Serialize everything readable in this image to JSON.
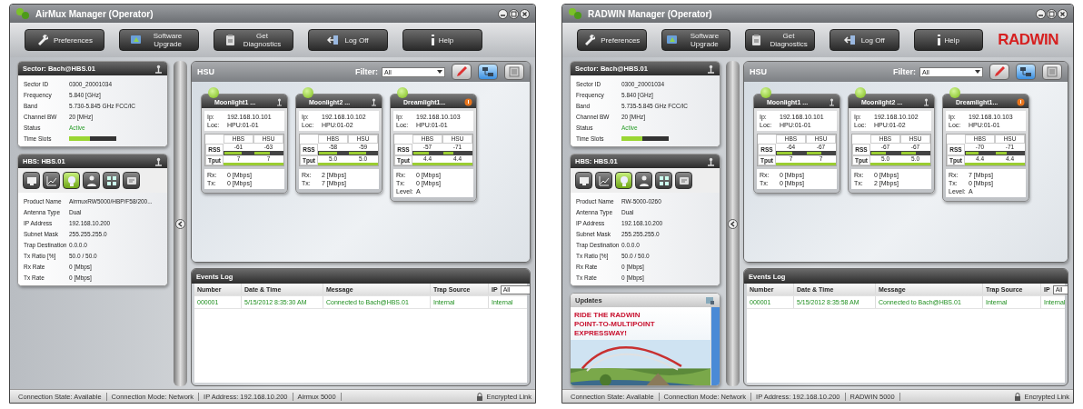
{
  "windows": [
    {
      "title": "AirMux Manager (Operator)",
      "toolbar": [
        {
          "label": "Preferences",
          "kind": "wrench"
        },
        {
          "label": "Software Upgrade",
          "kind": "upgrade"
        },
        {
          "label": "Get Diagnostics",
          "kind": "diagnostics"
        },
        {
          "label": "Log Off",
          "kind": "logoff"
        },
        {
          "label": "Help",
          "kind": "help"
        }
      ],
      "sector": {
        "title": "Sector: Bach@HBS.01",
        "rows": [
          {
            "kind": "text",
            "label": "Sector ID",
            "value": "0300_20001034"
          },
          {
            "kind": "text",
            "label": "Frequency",
            "value": "5.840 [GHz]"
          },
          {
            "kind": "text",
            "label": "Band",
            "value": "5.730-5.845 GHz FCC/IC"
          },
          {
            "kind": "text",
            "label": "Channel BW",
            "value": "20 [MHz]"
          },
          {
            "kind": "status",
            "label": "Status",
            "value": "Active"
          },
          {
            "kind": "meter",
            "label": "Time Slots",
            "level": 0.45
          }
        ]
      },
      "hbs": {
        "title": "HBS: HBS.01",
        "tools": [
          {
            "kind": "monitor",
            "selected": false
          },
          {
            "kind": "chart",
            "selected": false
          },
          {
            "kind": "bulb",
            "selected": true
          },
          {
            "kind": "person",
            "selected": false
          },
          {
            "kind": "grid",
            "selected": false
          },
          {
            "kind": "card",
            "selected": false
          }
        ],
        "rows": [
          {
            "kind": "text",
            "label": "Product Name",
            "value": "AirmuxRW5000/HBP/F58/200..."
          },
          {
            "kind": "text",
            "label": "Antenna Type",
            "value": "Dual"
          },
          {
            "kind": "text",
            "label": "IP Address",
            "value": "192.168.10.200"
          },
          {
            "kind": "text",
            "label": "Subnet Mask",
            "value": "255.255.255.0"
          },
          {
            "kind": "text",
            "label": "Trap Destination",
            "value": "0.0.0.0"
          },
          {
            "kind": "text",
            "label": "Tx Ratio [%]",
            "value": "50.0 / 50.0"
          },
          {
            "kind": "text",
            "label": "Rx Rate",
            "value": "0 [Mbps]"
          },
          {
            "kind": "text",
            "label": "Tx Rate",
            "value": "0 [Mbps]"
          }
        ]
      },
      "hsu": {
        "title": "HSU",
        "filter_label": "Filter:",
        "filter_value": "All",
        "views": [
          {
            "kind": "edit",
            "selected": false
          },
          {
            "kind": "map",
            "selected": true
          },
          {
            "kind": "list",
            "selected": false
          }
        ],
        "cards": [
          {
            "name": "Moonlight1 ...",
            "online": true,
            "alarm": false,
            "info": [
              {
                "label": "Ip:",
                "value": "192.168.10.101"
              },
              {
                "label": "Loc:",
                "value": "HPU:01-01"
              }
            ],
            "columns": [
              "HBS",
              "HSU"
            ],
            "rows": [
              {
                "label": "RSS",
                "cells": [
                  {
                    "text": "-61",
                    "level": 0.6
                  },
                  {
                    "text": "-63",
                    "level": 0.55
                  }
                ]
              },
              {
                "label": "Tput",
                "cells": [
                  {
                    "text": "7"
                  },
                  {
                    "text": "7"
                  }
                ]
              }
            ],
            "rates": [
              {
                "label": "Rx:",
                "value": "0 [Mbps]"
              },
              {
                "label": "Tx:",
                "value": "0 [Mbps]"
              }
            ]
          },
          {
            "name": "Moonlight2 ...",
            "online": true,
            "alarm": false,
            "info": [
              {
                "label": "Ip:",
                "value": "192.168.10.102"
              },
              {
                "label": "Loc:",
                "value": "HPU:01-02"
              }
            ],
            "columns": [
              "HBS",
              "HSU"
            ],
            "rows": [
              {
                "label": "RSS",
                "cells": [
                  {
                    "text": "-58",
                    "level": 0.65
                  },
                  {
                    "text": "-59",
                    "level": 0.62
                  }
                ]
              },
              {
                "label": "Tput",
                "cells": [
                  {
                    "text": "5.0"
                  },
                  {
                    "text": "5.0"
                  }
                ]
              }
            ],
            "rates": [
              {
                "label": "Rx:",
                "value": "2 [Mbps]"
              },
              {
                "label": "Tx:",
                "value": "7 [Mbps]"
              }
            ]
          },
          {
            "name": "Dreamlight1...",
            "online": true,
            "alarm": true,
            "info": [
              {
                "label": "Ip:",
                "value": "192.168.10.103"
              },
              {
                "label": "Loc:",
                "value": "HPU:01-01"
              }
            ],
            "columns": [
              "HBS",
              "HSU"
            ],
            "rows": [
              {
                "label": "RSS",
                "cells": [
                  {
                    "text": "-57",
                    "level": 0.55
                  },
                  {
                    "text": "-71",
                    "level": 0.35
                  }
                ]
              },
              {
                "label": "Tput",
                "cells": [
                  {
                    "text": "4.4"
                  },
                  {
                    "text": "4.4"
                  }
                ]
              }
            ],
            "rates": [
              {
                "label": "Rx:",
                "value": "0 [Mbps]"
              },
              {
                "label": "Tx:",
                "value": "0 [Mbps]"
              },
              {
                "label": "Level:",
                "value": "A"
              }
            ]
          }
        ]
      },
      "events": {
        "title": "Events Log",
        "columns": [
          "Number",
          "Date & Time",
          "Message",
          "Trap Source",
          "IP"
        ],
        "ip_filter": "All",
        "rows": [
          [
            "000001",
            "5/15/2012 8:35:30 AM",
            "Connected to Bach@HBS.01",
            "Internal",
            "Internal"
          ]
        ]
      },
      "status_bar": [
        "Connection State: Available",
        "Connection Mode: Network",
        "IP Address: 192.168.10.200",
        "Airmux 5000"
      ],
      "encrypted": "Encrypted Link"
    },
    {
      "title": "RADWIN Manager (Operator)",
      "logo": "RADWIN",
      "toolbar": [
        {
          "label": "Preferences",
          "kind": "wrench"
        },
        {
          "label": "Software Upgrade",
          "kind": "upgrade"
        },
        {
          "label": "Get Diagnostics",
          "kind": "diagnostics"
        },
        {
          "label": "Log Off",
          "kind": "logoff"
        },
        {
          "label": "Help",
          "kind": "help"
        }
      ],
      "sector": {
        "title": "Sector: Bach@HBS.01",
        "rows": [
          {
            "kind": "text",
            "label": "Sector ID",
            "value": "0300_20001034"
          },
          {
            "kind": "text",
            "label": "Frequency",
            "value": "5.840 [GHz]"
          },
          {
            "kind": "text",
            "label": "Band",
            "value": "5.735-5.845 GHz FCC/IC"
          },
          {
            "kind": "text",
            "label": "Channel BW",
            "value": "20 [MHz]"
          },
          {
            "kind": "status",
            "label": "Status",
            "value": "Active"
          },
          {
            "kind": "meter",
            "label": "Time Slots",
            "level": 0.45
          }
        ]
      },
      "hbs": {
        "title": "HBS: HBS.01",
        "tools": [
          {
            "kind": "monitor",
            "selected": false
          },
          {
            "kind": "chart",
            "selected": false
          },
          {
            "kind": "bulb",
            "selected": true
          },
          {
            "kind": "person",
            "selected": false
          },
          {
            "kind": "grid",
            "selected": false
          },
          {
            "kind": "card",
            "selected": false
          }
        ],
        "rows": [
          {
            "kind": "text",
            "label": "Product Name",
            "value": "RW-5000-0260"
          },
          {
            "kind": "text",
            "label": "Antenna Type",
            "value": "Dual"
          },
          {
            "kind": "text",
            "label": "IP Address",
            "value": "192.168.10.200"
          },
          {
            "kind": "text",
            "label": "Subnet Mask",
            "value": "255.255.255.0"
          },
          {
            "kind": "text",
            "label": "Trap Destination",
            "value": "0.0.0.0"
          },
          {
            "kind": "text",
            "label": "Tx Ratio [%]",
            "value": "50.0 / 50.0"
          },
          {
            "kind": "text",
            "label": "Rx Rate",
            "value": "0 [Mbps]"
          },
          {
            "kind": "text",
            "label": "Tx Rate",
            "value": "0 [Mbps]"
          }
        ]
      },
      "updates": {
        "title": "Updates",
        "headline": [
          "RIDE THE RADWIN",
          "POINT-TO-MULTIPOINT",
          "EXPRESSWAY!"
        ]
      },
      "hsu": {
        "title": "HSU",
        "filter_label": "Filter:",
        "filter_value": "All",
        "views": [
          {
            "kind": "edit",
            "selected": false
          },
          {
            "kind": "map",
            "selected": true
          },
          {
            "kind": "list",
            "selected": false
          }
        ],
        "cards": [
          {
            "name": "Moonlight1 ...",
            "online": true,
            "alarm": false,
            "info": [
              {
                "label": "Ip:",
                "value": "192.168.10.101"
              },
              {
                "label": "Loc:",
                "value": "HPU:01-01"
              }
            ],
            "columns": [
              "HBS",
              "HSU"
            ],
            "rows": [
              {
                "label": "RSS",
                "cells": [
                  {
                    "text": "-64",
                    "level": 0.55
                  },
                  {
                    "text": "-67",
                    "level": 0.5
                  }
                ]
              },
              {
                "label": "Tput",
                "cells": [
                  {
                    "text": "7"
                  },
                  {
                    "text": "7"
                  }
                ]
              }
            ],
            "rates": [
              {
                "label": "Rx:",
                "value": "0 [Mbps]"
              },
              {
                "label": "Tx:",
                "value": "0 [Mbps]"
              }
            ]
          },
          {
            "name": "Moonlight2 ...",
            "online": true,
            "alarm": false,
            "info": [
              {
                "label": "Ip:",
                "value": "192.168.10.102"
              },
              {
                "label": "Loc:",
                "value": "HPU:01-02"
              }
            ],
            "columns": [
              "HBS",
              "HSU"
            ],
            "rows": [
              {
                "label": "RSS",
                "cells": [
                  {
                    "text": "-67",
                    "level": 0.5
                  },
                  {
                    "text": "-67",
                    "level": 0.5
                  }
                ]
              },
              {
                "label": "Tput",
                "cells": [
                  {
                    "text": "5.0"
                  },
                  {
                    "text": "5.0"
                  }
                ]
              }
            ],
            "rates": [
              {
                "label": "Rx:",
                "value": "0 [Mbps]"
              },
              {
                "label": "Tx:",
                "value": "2 [Mbps]"
              }
            ]
          },
          {
            "name": "Dreamlight1...",
            "online": true,
            "alarm": true,
            "info": [
              {
                "label": "Ip:",
                "value": "192.168.10.103"
              },
              {
                "label": "Loc:",
                "value": "HPU:01-01"
              }
            ],
            "columns": [
              "HBS",
              "HSU"
            ],
            "rows": [
              {
                "label": "RSS",
                "cells": [
                  {
                    "text": "-70",
                    "level": 0.45
                  },
                  {
                    "text": "-71",
                    "level": 0.4
                  }
                ]
              },
              {
                "label": "Tput",
                "cells": [
                  {
                    "text": "4.4"
                  },
                  {
                    "text": "4.4"
                  }
                ]
              }
            ],
            "rates": [
              {
                "label": "Rx:",
                "value": "7 [Mbps]"
              },
              {
                "label": "Tx:",
                "value": "0 [Mbps]"
              },
              {
                "label": "Level:",
                "value": "A"
              }
            ]
          }
        ]
      },
      "events": {
        "title": "Events Log",
        "columns": [
          "Number",
          "Date & Time",
          "Message",
          "Trap Source",
          "IP"
        ],
        "ip_filter": "All",
        "rows": [
          [
            "000001",
            "5/15/2012 8:35:58 AM",
            "Connected to Bach@HBS.01",
            "Internal",
            "Internal"
          ]
        ]
      },
      "status_bar": [
        "Connection State: Available",
        "Connection Mode: Network",
        "IP Address: 192.168.10.200",
        "RADWIN 5000"
      ],
      "encrypted": "Encrypted Link"
    }
  ]
}
